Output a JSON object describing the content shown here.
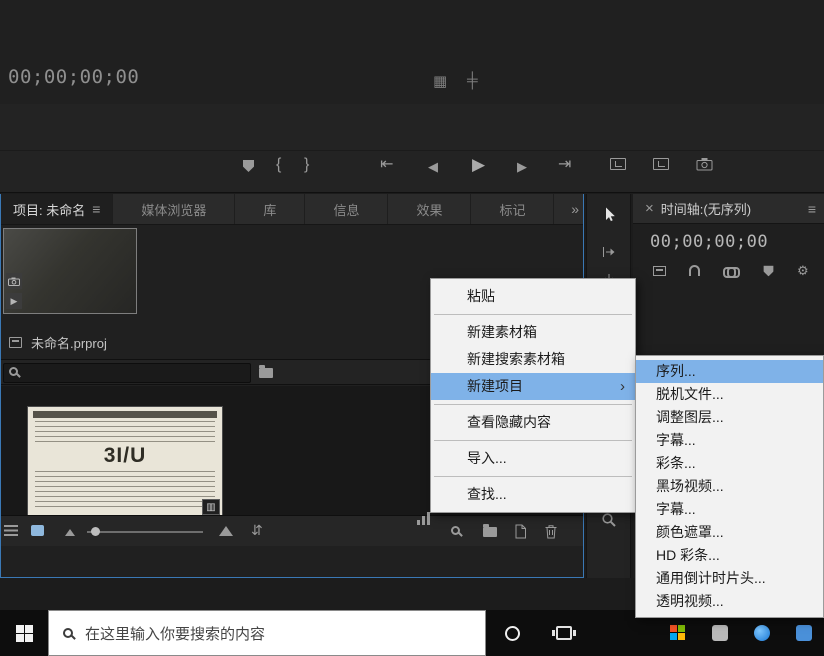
{
  "colors": {
    "menu_highlight": "#7fb2e8",
    "panel_focus_border": "#3a78b5",
    "icon_gray": "#9a9a9a"
  },
  "monitor": {
    "timecode": "00;00;00;00"
  },
  "icons": {
    "panel_menu": "≡",
    "overflow": "»",
    "close": "×",
    "brace_open": "{",
    "brace_close": "}",
    "goto_in": "⇤",
    "step_back": "◀",
    "play": "▶",
    "step_forward": "▶",
    "goto_out": "⇥",
    "grid": "▦",
    "compare": "╪",
    "sort": "⇵",
    "gear": "⚙",
    "submenu_arrow": "›",
    "film": "▥"
  },
  "project_panel": {
    "tabs": [
      "项目: 未命名",
      "媒体浏览器",
      "库",
      "信息",
      "效果",
      "标记"
    ],
    "active_tab": "项目: 未命名",
    "project_file": "未命名.prproj",
    "bin_item_preview_text": "3I/U",
    "search_value": ""
  },
  "timeline_panel": {
    "title": "时间轴:(无序列)",
    "timecode": "00;00;00;00"
  },
  "context_menu": {
    "items": [
      "粘贴",
      "新建素材箱",
      "新建搜索素材箱",
      "新建项目",
      "查看隐藏内容",
      "导入...",
      "查找..."
    ],
    "highlighted": "新建项目"
  },
  "submenu": {
    "items": [
      "序列...",
      "脱机文件...",
      "调整图层...",
      "字幕...",
      "彩条...",
      "黑场视频...",
      "字幕...",
      "颜色遮罩...",
      "HD 彩条...",
      "通用倒计时片头...",
      "透明视频..."
    ],
    "highlighted": "序列..."
  },
  "taskbar": {
    "search_placeholder": "在这里输入你要搜索的内容"
  }
}
